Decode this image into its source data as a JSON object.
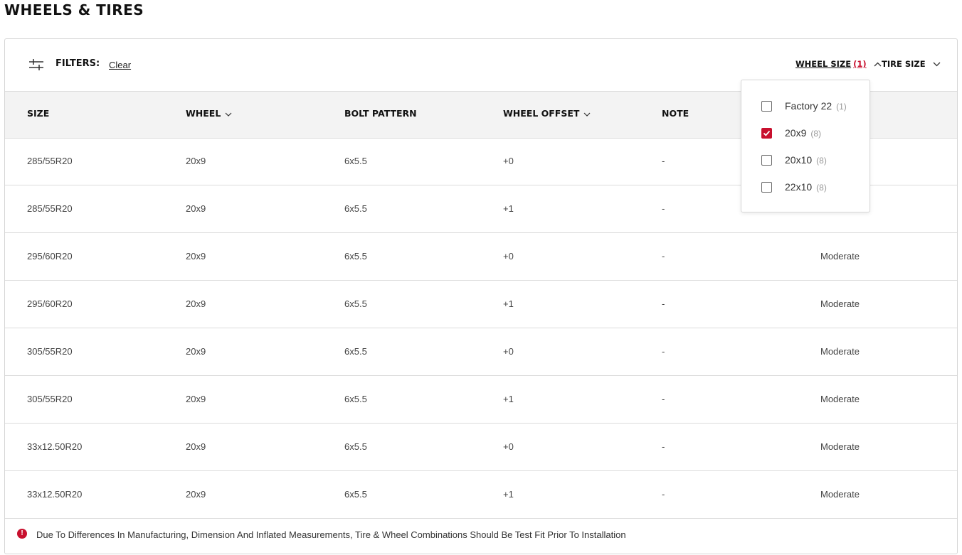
{
  "title": "WHEELS & TIRES",
  "filters": {
    "label": "FILTERS:",
    "clear": "Clear",
    "wheel_size": {
      "label": "WHEEL SIZE",
      "count": "(1)"
    },
    "tire_size": {
      "label": "TIRE SIZE"
    }
  },
  "columns": [
    "SIZE",
    "WHEEL",
    "BOLT PATTERN",
    "WHEEL OFFSET",
    "NOTE"
  ],
  "rows": [
    {
      "size": "285/55R20",
      "wheel": "20x9",
      "bolt": "6x5.5",
      "offset": "+0",
      "note": "-",
      "fit": ""
    },
    {
      "size": "285/55R20",
      "wheel": "20x9",
      "bolt": "6x5.5",
      "offset": "+1",
      "note": "-",
      "fit": ""
    },
    {
      "size": "295/60R20",
      "wheel": "20x9",
      "bolt": "6x5.5",
      "offset": "+0",
      "note": "-",
      "fit": "Moderate"
    },
    {
      "size": "295/60R20",
      "wheel": "20x9",
      "bolt": "6x5.5",
      "offset": "+1",
      "note": "-",
      "fit": "Moderate"
    },
    {
      "size": "305/55R20",
      "wheel": "20x9",
      "bolt": "6x5.5",
      "offset": "+0",
      "note": "-",
      "fit": "Moderate"
    },
    {
      "size": "305/55R20",
      "wheel": "20x9",
      "bolt": "6x5.5",
      "offset": "+1",
      "note": "-",
      "fit": "Moderate"
    },
    {
      "size": "33x12.50R20",
      "wheel": "20x9",
      "bolt": "6x5.5",
      "offset": "+0",
      "note": "-",
      "fit": "Moderate"
    },
    {
      "size": "33x12.50R20",
      "wheel": "20x9",
      "bolt": "6x5.5",
      "offset": "+1",
      "note": "-",
      "fit": "Moderate"
    }
  ],
  "dropdown": {
    "options": [
      {
        "label": "Factory 22",
        "count": "(1)",
        "checked": false
      },
      {
        "label": "20x9",
        "count": "(8)",
        "checked": true
      },
      {
        "label": "20x10",
        "count": "(8)",
        "checked": false
      },
      {
        "label": "22x10",
        "count": "(8)",
        "checked": false
      }
    ]
  },
  "footnote": "Due To Differences In Manufacturing, Dimension And Inflated Measurements, Tire & Wheel Combinations Should Be Test Fit Prior To Installation",
  "colors": {
    "accent": "#c8102e",
    "header_bg": "#f3f3f3"
  },
  "icons": {
    "filter": "sliders-icon",
    "alert": "exclamation-circle-icon"
  }
}
